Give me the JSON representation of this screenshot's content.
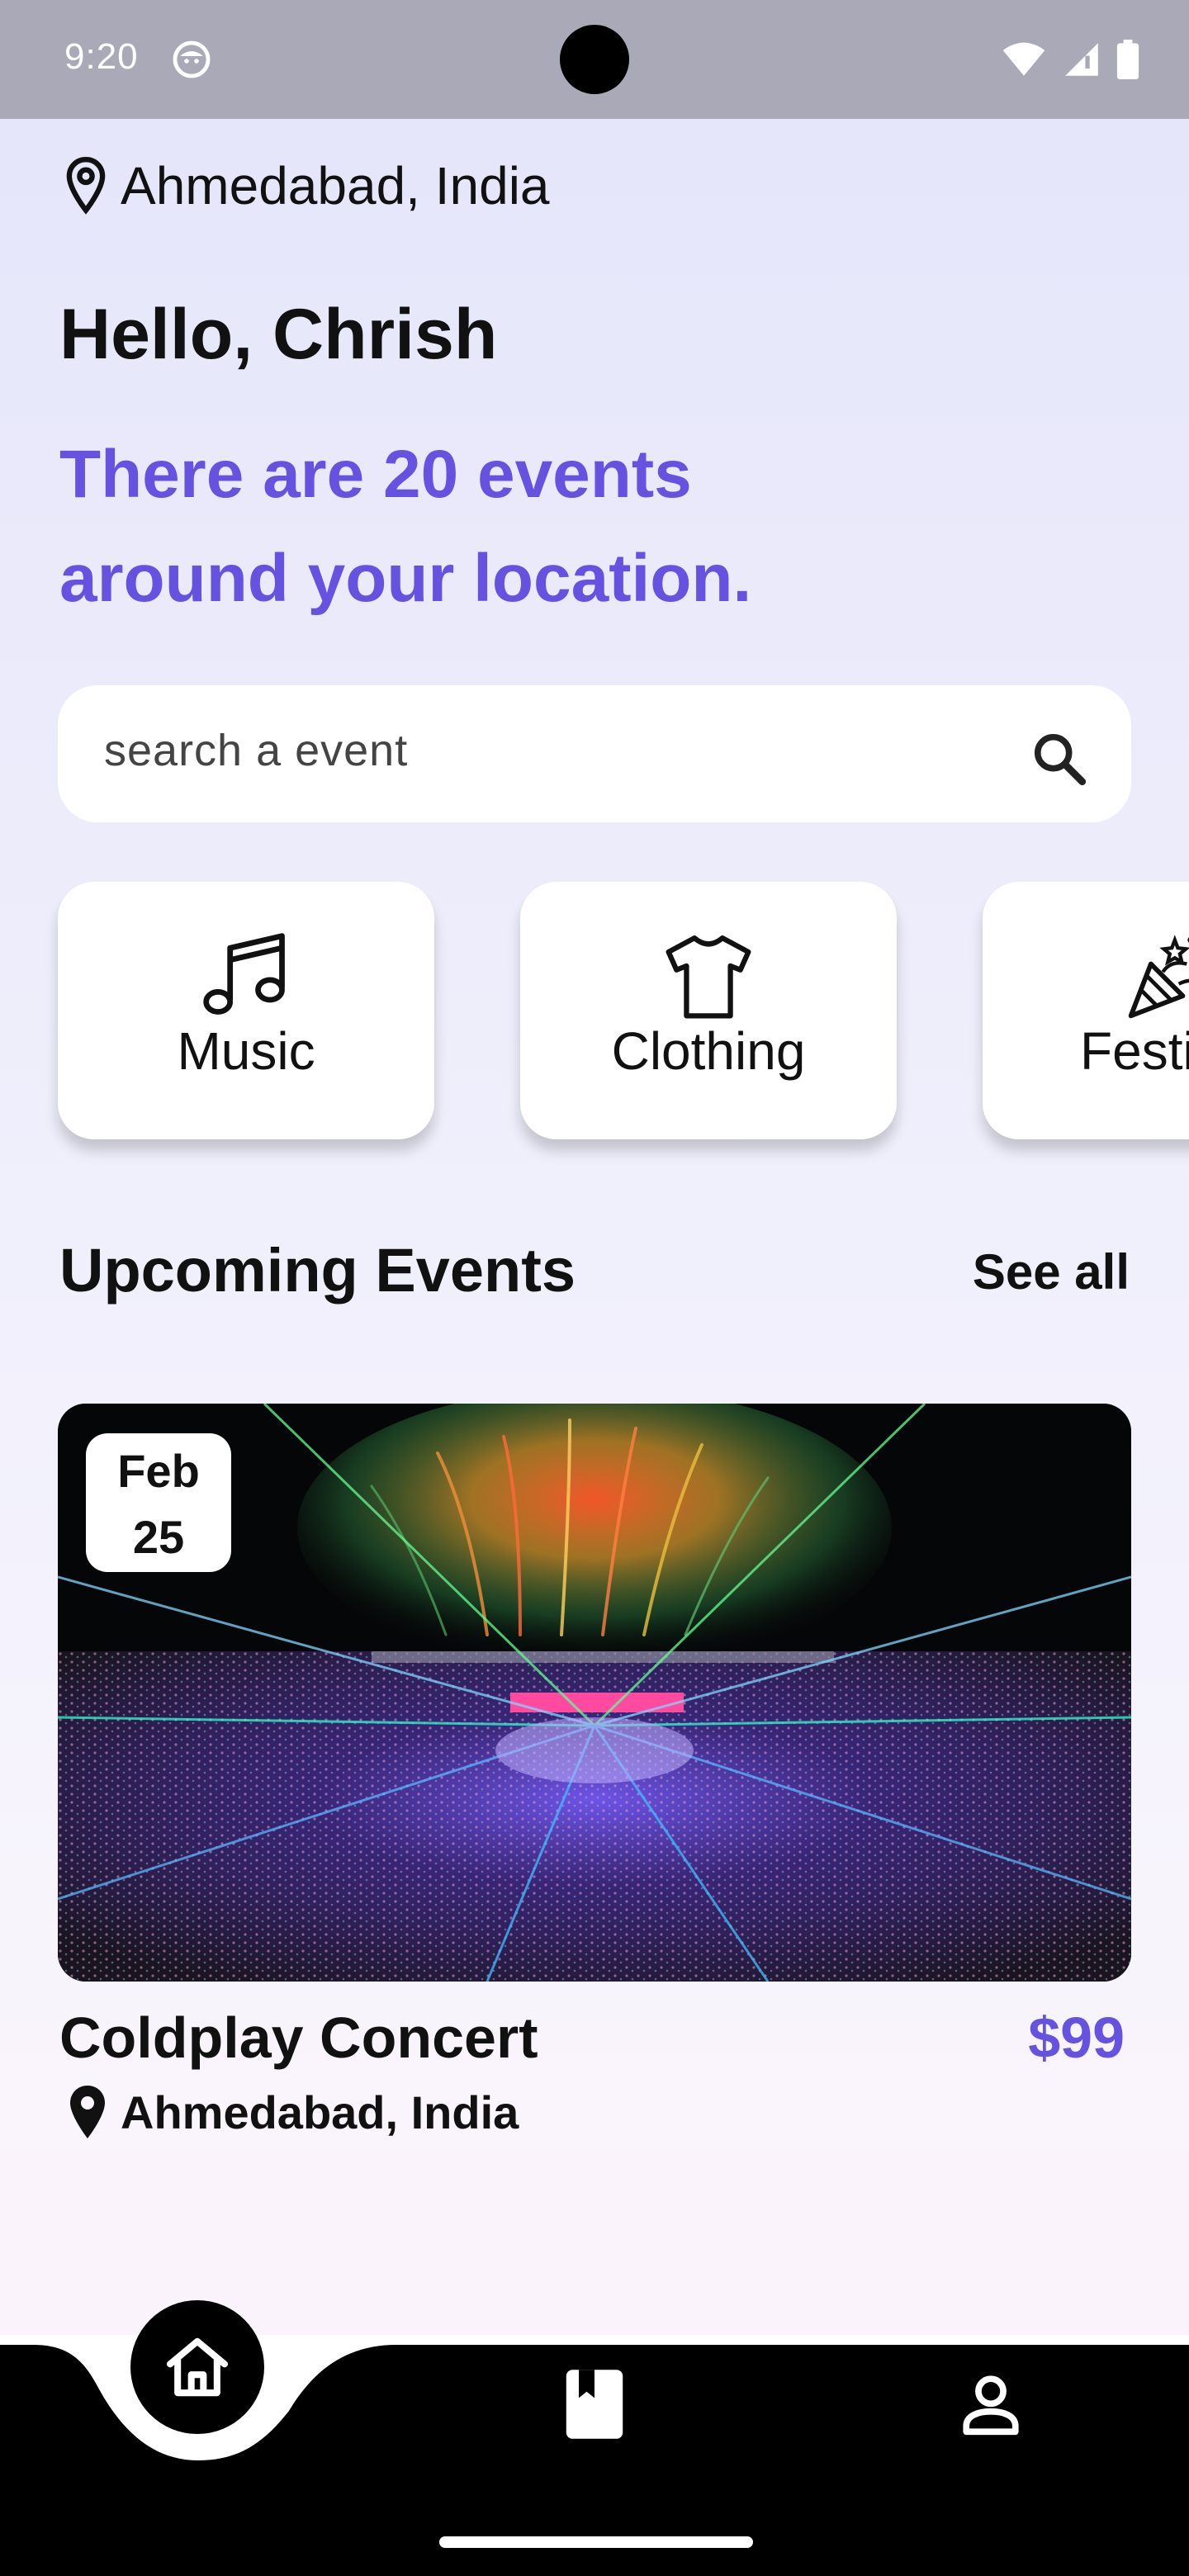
{
  "status_bar": {
    "time": "9:20",
    "icons": [
      "face-icon",
      "wifi-icon",
      "signal-icon",
      "battery-icon"
    ]
  },
  "header": {
    "location": "Ahmedabad, India",
    "greeting": "Hello, Chrish",
    "headline": "There are 20 events around your location."
  },
  "search": {
    "placeholder": "search a event",
    "value": ""
  },
  "categories": [
    {
      "label": "Music",
      "icon": "music-note-icon"
    },
    {
      "label": "Clothing",
      "icon": "tshirt-icon"
    },
    {
      "label": "Festival",
      "icon": "party-popper-icon"
    }
  ],
  "upcoming": {
    "title": "Upcoming Events",
    "see_all": "See all"
  },
  "event": {
    "month": "Feb",
    "day": "25",
    "title": "Coldplay Concert",
    "price": "$99",
    "location": "Ahmedabad, India"
  },
  "nav": {
    "items": [
      "home-icon",
      "bookmark-icon",
      "profile-icon"
    ],
    "active": "home"
  },
  "colors": {
    "accent": "#6552e0",
    "nav_bg": "#000000",
    "status_bar": "#a9a9b8"
  }
}
